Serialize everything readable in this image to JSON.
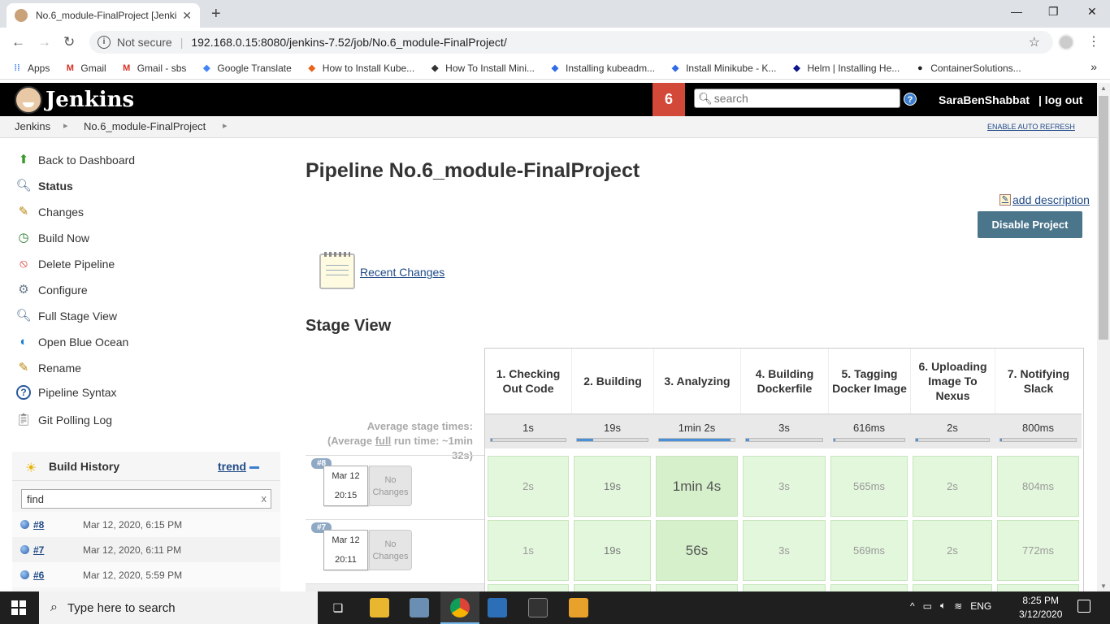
{
  "browser": {
    "tab_title": "No.6_module-FinalProject [Jenkins]",
    "tab_close": "✕",
    "new_tab": "+",
    "security": "Not secure",
    "url": "192.168.0.15:8080/jenkins-7.52/job/No.6_module-FinalProject/",
    "bookmarks": [
      {
        "label": "Apps",
        "icon": "apps-grid-icon",
        "color": "#4285f4"
      },
      {
        "label": "Gmail",
        "icon": "gmail-icon",
        "color": "#d93025"
      },
      {
        "label": "Gmail - sbs",
        "icon": "gmail-icon",
        "color": "#d93025"
      },
      {
        "label": "Google Translate",
        "icon": "translate-icon",
        "color": "#4285f4"
      },
      {
        "label": "How to Install Kube...",
        "icon": "site-icon",
        "color": "#e8641b"
      },
      {
        "label": "How To Install Mini...",
        "icon": "site-icon",
        "color": "#333333"
      },
      {
        "label": "Installing kubeadm...",
        "icon": "kubernetes-icon",
        "color": "#326ce5"
      },
      {
        "label": "Install Minikube - K...",
        "icon": "kubernetes-icon",
        "color": "#326ce5"
      },
      {
        "label": "Helm | Installing He...",
        "icon": "helm-icon",
        "color": "#0f1689"
      },
      {
        "label": "ContainerSolutions...",
        "icon": "github-icon",
        "color": "#222222"
      }
    ],
    "bookmarks_more": "»"
  },
  "jenkins": {
    "logo_text": "Jenkins",
    "notification_count": "6",
    "search_placeholder": "search",
    "help": "?",
    "user": "SaraBenShabbat",
    "logout": "| log out",
    "breadcrumbs": [
      "Jenkins",
      "No.6_module-FinalProject"
    ],
    "auto_refresh": "ENABLE AUTO REFRESH"
  },
  "sidebar": {
    "items": [
      {
        "label": "Back to Dashboard",
        "icon": "up-arrow-icon"
      },
      {
        "label": "Status",
        "icon": "search-icon"
      },
      {
        "label": "Changes",
        "icon": "notepad-icon"
      },
      {
        "label": "Build Now",
        "icon": "clock-play-icon"
      },
      {
        "label": "Delete Pipeline",
        "icon": "no-entry-icon"
      },
      {
        "label": "Configure",
        "icon": "gear-icon"
      },
      {
        "label": "Full Stage View",
        "icon": "search-icon"
      },
      {
        "label": "Open Blue Ocean",
        "icon": "blue-ocean-icon"
      },
      {
        "label": "Rename",
        "icon": "notepad-icon"
      },
      {
        "label": "Pipeline Syntax",
        "icon": "help-icon"
      },
      {
        "label": "Git Polling Log",
        "icon": "clipboard-icon"
      }
    ]
  },
  "build_history": {
    "title": "Build History",
    "trend": "trend",
    "find_value": "find",
    "find_clear": "x",
    "builds": [
      {
        "num": "#8",
        "date": "Mar 12, 2020, 6:15 PM"
      },
      {
        "num": "#7",
        "date": "Mar 12, 2020, 6:11 PM"
      },
      {
        "num": "#6",
        "date": "Mar 12, 2020, 5:59 PM"
      }
    ]
  },
  "main": {
    "title": "Pipeline No.6_module-FinalProject",
    "add_description": "add description",
    "disable_button": "Disable Project",
    "recent_changes": "Recent Changes",
    "stage_view_title": "Stage View",
    "avg_label_1": "Average stage times:",
    "avg_label_2a": "(Average ",
    "avg_label_2b": "full",
    "avg_label_2c": " run time: ~1min",
    "avg_label_3": "32s)"
  },
  "stages": [
    {
      "name": "1. Checking Out Code",
      "avg": "1s",
      "avg_fraction": 0.02
    },
    {
      "name": "2. Building",
      "avg": "19s",
      "avg_fraction": 0.23
    },
    {
      "name": "3. Analyzing",
      "avg": "1min 2s",
      "avg_fraction": 0.95
    },
    {
      "name": "4. Building Dockerfile",
      "avg": "3s",
      "avg_fraction": 0.04
    },
    {
      "name": "5. Tagging Docker Image",
      "avg": "616ms",
      "avg_fraction": 0.01
    },
    {
      "name": "6. Uploading Image To Nexus",
      "avg": "2s",
      "avg_fraction": 0.03
    },
    {
      "name": "7. Notifying Slack",
      "avg": "800ms",
      "avg_fraction": 0.01
    }
  ],
  "runs": [
    {
      "badge": "#8",
      "date": "Mar 12",
      "time": "20:15",
      "changes": "No Changes",
      "durations": [
        "2s",
        "19s",
        "1min 4s",
        "3s",
        "565ms",
        "2s",
        "804ms"
      ]
    },
    {
      "badge": "#7",
      "date": "Mar 12",
      "time": "20:11",
      "changes": "No Changes",
      "durations": [
        "1s",
        "19s",
        "56s",
        "3s",
        "569ms",
        "2s",
        "772ms"
      ]
    }
  ],
  "taskbar": {
    "search_placeholder": "Type here to search",
    "language": "ENG",
    "time": "8:25 PM",
    "date": "3/12/2020"
  }
}
